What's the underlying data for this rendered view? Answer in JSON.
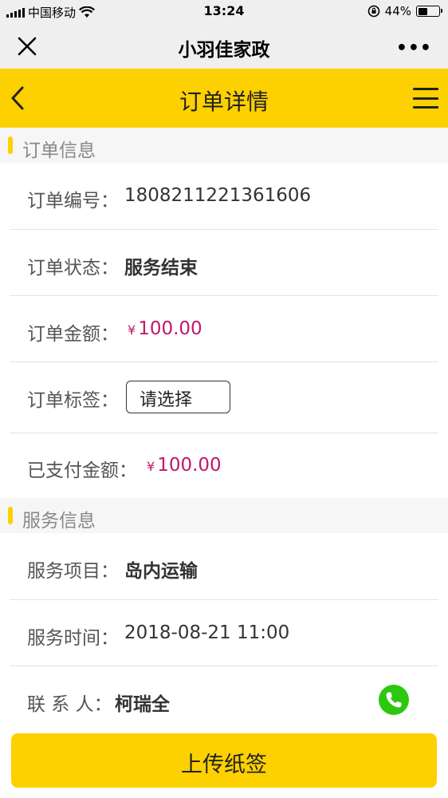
{
  "status_bar": {
    "carrier": "中国移动",
    "time": "13:24",
    "battery": "44%"
  },
  "wechat_bar": {
    "title": "小羽佳家政",
    "more": "•••"
  },
  "header": {
    "title": "订单详情"
  },
  "order_section": {
    "title": "订单信息",
    "order_number_label": "订单编号：",
    "order_number": "1808211221361606",
    "status_label": "订单状态：",
    "status": "服务结束",
    "amount_label": "订单金额：",
    "amount_currency": "¥",
    "amount": "100.00",
    "tag_label": "订单标签：",
    "tag_placeholder": "请选择",
    "paid_label": "已支付金额：",
    "paid_currency": "¥",
    "paid": "100.00"
  },
  "service_section": {
    "title": "服务信息",
    "item_label": "服务项目：",
    "item": "岛内运输",
    "time_label": "服务时间：",
    "time": "2018-08-21 11:00",
    "contact_label": "联 系 人：",
    "contact": "柯瑞全"
  },
  "upload_button": "上传纸签",
  "colors": {
    "accent_yellow": "#fdd000",
    "money_magenta": "#c0186a",
    "phone_green": "#2ec70f"
  }
}
